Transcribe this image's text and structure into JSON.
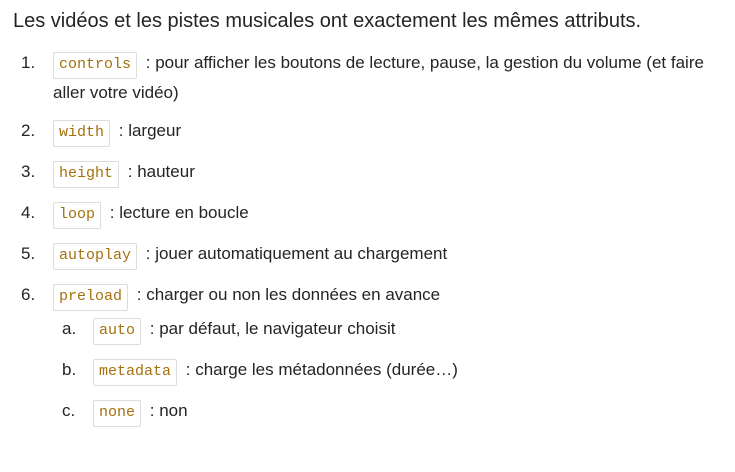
{
  "intro": "Les vidéos et les pistes musicales ont exactement les mêmes attributs.",
  "items": [
    {
      "num": "1.",
      "code": "controls",
      "text": ": pour afficher les boutons de lecture, pause, la gestion du volume (et faire aller votre vidéo)"
    },
    {
      "num": "2.",
      "code": "width",
      "text": ": largeur"
    },
    {
      "num": "3.",
      "code": "height",
      "text": ": hauteur"
    },
    {
      "num": "4.",
      "code": "loop",
      "text": ": lecture en boucle"
    },
    {
      "num": "5.",
      "code": "autoplay",
      "text": ": jouer automatiquement au chargement"
    },
    {
      "num": "6.",
      "code": "preload",
      "text": ": charger ou non les données en avance"
    }
  ],
  "subitems": [
    {
      "num": "a.",
      "code": "auto",
      "text": ": par défaut, le navigateur choisit"
    },
    {
      "num": "b.",
      "code": "metadata",
      "text": ": charge les métadonnées (durée…)"
    },
    {
      "num": "c.",
      "code": "none",
      "text": ": non"
    }
  ]
}
